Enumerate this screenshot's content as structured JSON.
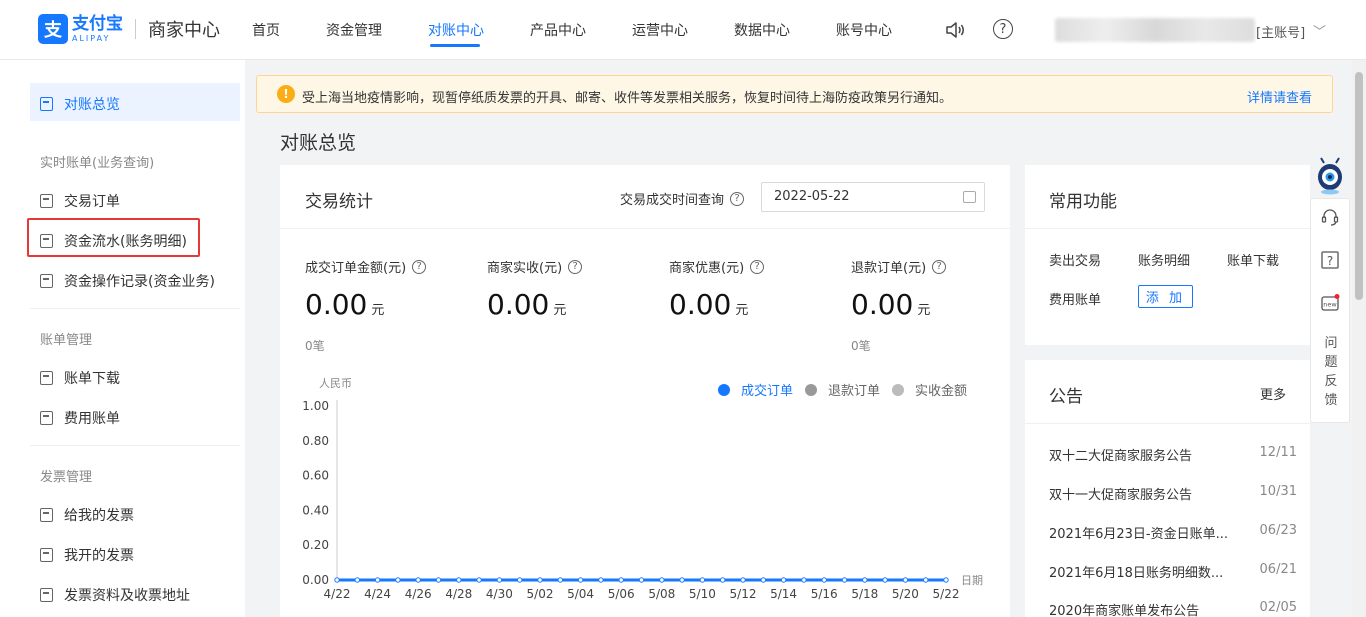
{
  "brand": {
    "logo_cn": "支付宝",
    "logo_en": "ALIPAY",
    "app_name": "商家中心",
    "logo_glyph": "支",
    "color": "#1677ff"
  },
  "topnav": {
    "items": [
      {
        "label": "首页",
        "active": false
      },
      {
        "label": "资金管理",
        "active": false
      },
      {
        "label": "对账中心",
        "active": true
      },
      {
        "label": "产品中心",
        "active": false
      },
      {
        "label": "运营中心",
        "active": false
      },
      {
        "label": "数据中心",
        "active": false
      },
      {
        "label": "账号中心",
        "active": false
      }
    ],
    "help_glyph": "?",
    "account_label": "[主账号]",
    "chevron": "﹀"
  },
  "sidebar": {
    "overview": "对账总览",
    "group_realtime": "实时账单(业务查询)",
    "trade_orders": "交易订单",
    "fund_flow": "资金流水(账务明细)",
    "fund_ops": "资金操作记录(资金业务)",
    "group_bills": "账单管理",
    "bill_download": "账单下载",
    "fee_bill": "费用账单",
    "group_invoice": "发票管理",
    "invoice_to_me": "给我的发票",
    "invoice_issued": "我开的发票",
    "invoice_info": "发票资料及收票地址"
  },
  "notice": {
    "icon": "!",
    "text": "受上海当地疫情影响，现暂停纸质发票的开具、邮寄、收件等发票相关服务，恢复时间待上海防疫政策另行通知。",
    "link": "详情请查看"
  },
  "page_title": "对账总览",
  "stats": {
    "title": "交易统计",
    "date_label": "交易成交时间查询",
    "date_value": "2022-05-22",
    "help_glyph": "?",
    "metrics": [
      {
        "label": "成交订单金额(元)",
        "value": "0.00",
        "unit": "元",
        "count": "0笔"
      },
      {
        "label": "商家实收(元)",
        "value": "0.00",
        "unit": "元",
        "count": ""
      },
      {
        "label": "商家优惠(元)",
        "value": "0.00",
        "unit": "元",
        "count": ""
      },
      {
        "label": "退款订单(元)",
        "value": "0.00",
        "unit": "元",
        "count": "0笔"
      }
    ]
  },
  "chart_data": {
    "type": "line",
    "title": "",
    "ylabel": "人民币",
    "xlabel": "日期",
    "ylim": [
      0,
      1
    ],
    "yticks": [
      "1.00",
      "0.80",
      "0.60",
      "0.40",
      "0.20",
      "0.00"
    ],
    "xticks": [
      "4/22",
      "4/24",
      "4/26",
      "4/28",
      "4/30",
      "5/02",
      "5/04",
      "5/06",
      "5/08",
      "5/10",
      "5/12",
      "5/14",
      "5/16",
      "5/18",
      "5/20",
      "5/22"
    ],
    "legend_position": "top-right",
    "series": [
      {
        "name": "成交订单",
        "color": "#1677ff",
        "active": true,
        "values": [
          0,
          0,
          0,
          0,
          0,
          0,
          0,
          0,
          0,
          0,
          0,
          0,
          0,
          0,
          0,
          0,
          0,
          0,
          0,
          0,
          0,
          0,
          0,
          0,
          0,
          0,
          0,
          0,
          0,
          0,
          0
        ]
      },
      {
        "name": "退款订单",
        "color": "#999999",
        "active": false,
        "values": []
      },
      {
        "name": "实收金额",
        "color": "#bbbbbb",
        "active": false,
        "values": []
      }
    ]
  },
  "functions": {
    "title": "常用功能",
    "links": [
      "卖出交易",
      "账务明细",
      "账单下载",
      "费用账单"
    ],
    "add_label": "添 加"
  },
  "announcements": {
    "title": "公告",
    "more": "更多",
    "items": [
      {
        "text": "双十二大促商家服务公告",
        "date": "12/11"
      },
      {
        "text": "双十一大促商家服务公告",
        "date": "10/31"
      },
      {
        "text": "2021年6月23日-资金日账单...",
        "date": "06/23"
      },
      {
        "text": "2021年6月18日账务明细数...",
        "date": "06/21"
      },
      {
        "text": "2020年商家账单发布公告",
        "date": "02/05"
      }
    ]
  },
  "float_bar": {
    "feedback": [
      "问",
      "题",
      "反",
      "馈"
    ],
    "new_badge": "new",
    "help_glyph": "?"
  }
}
